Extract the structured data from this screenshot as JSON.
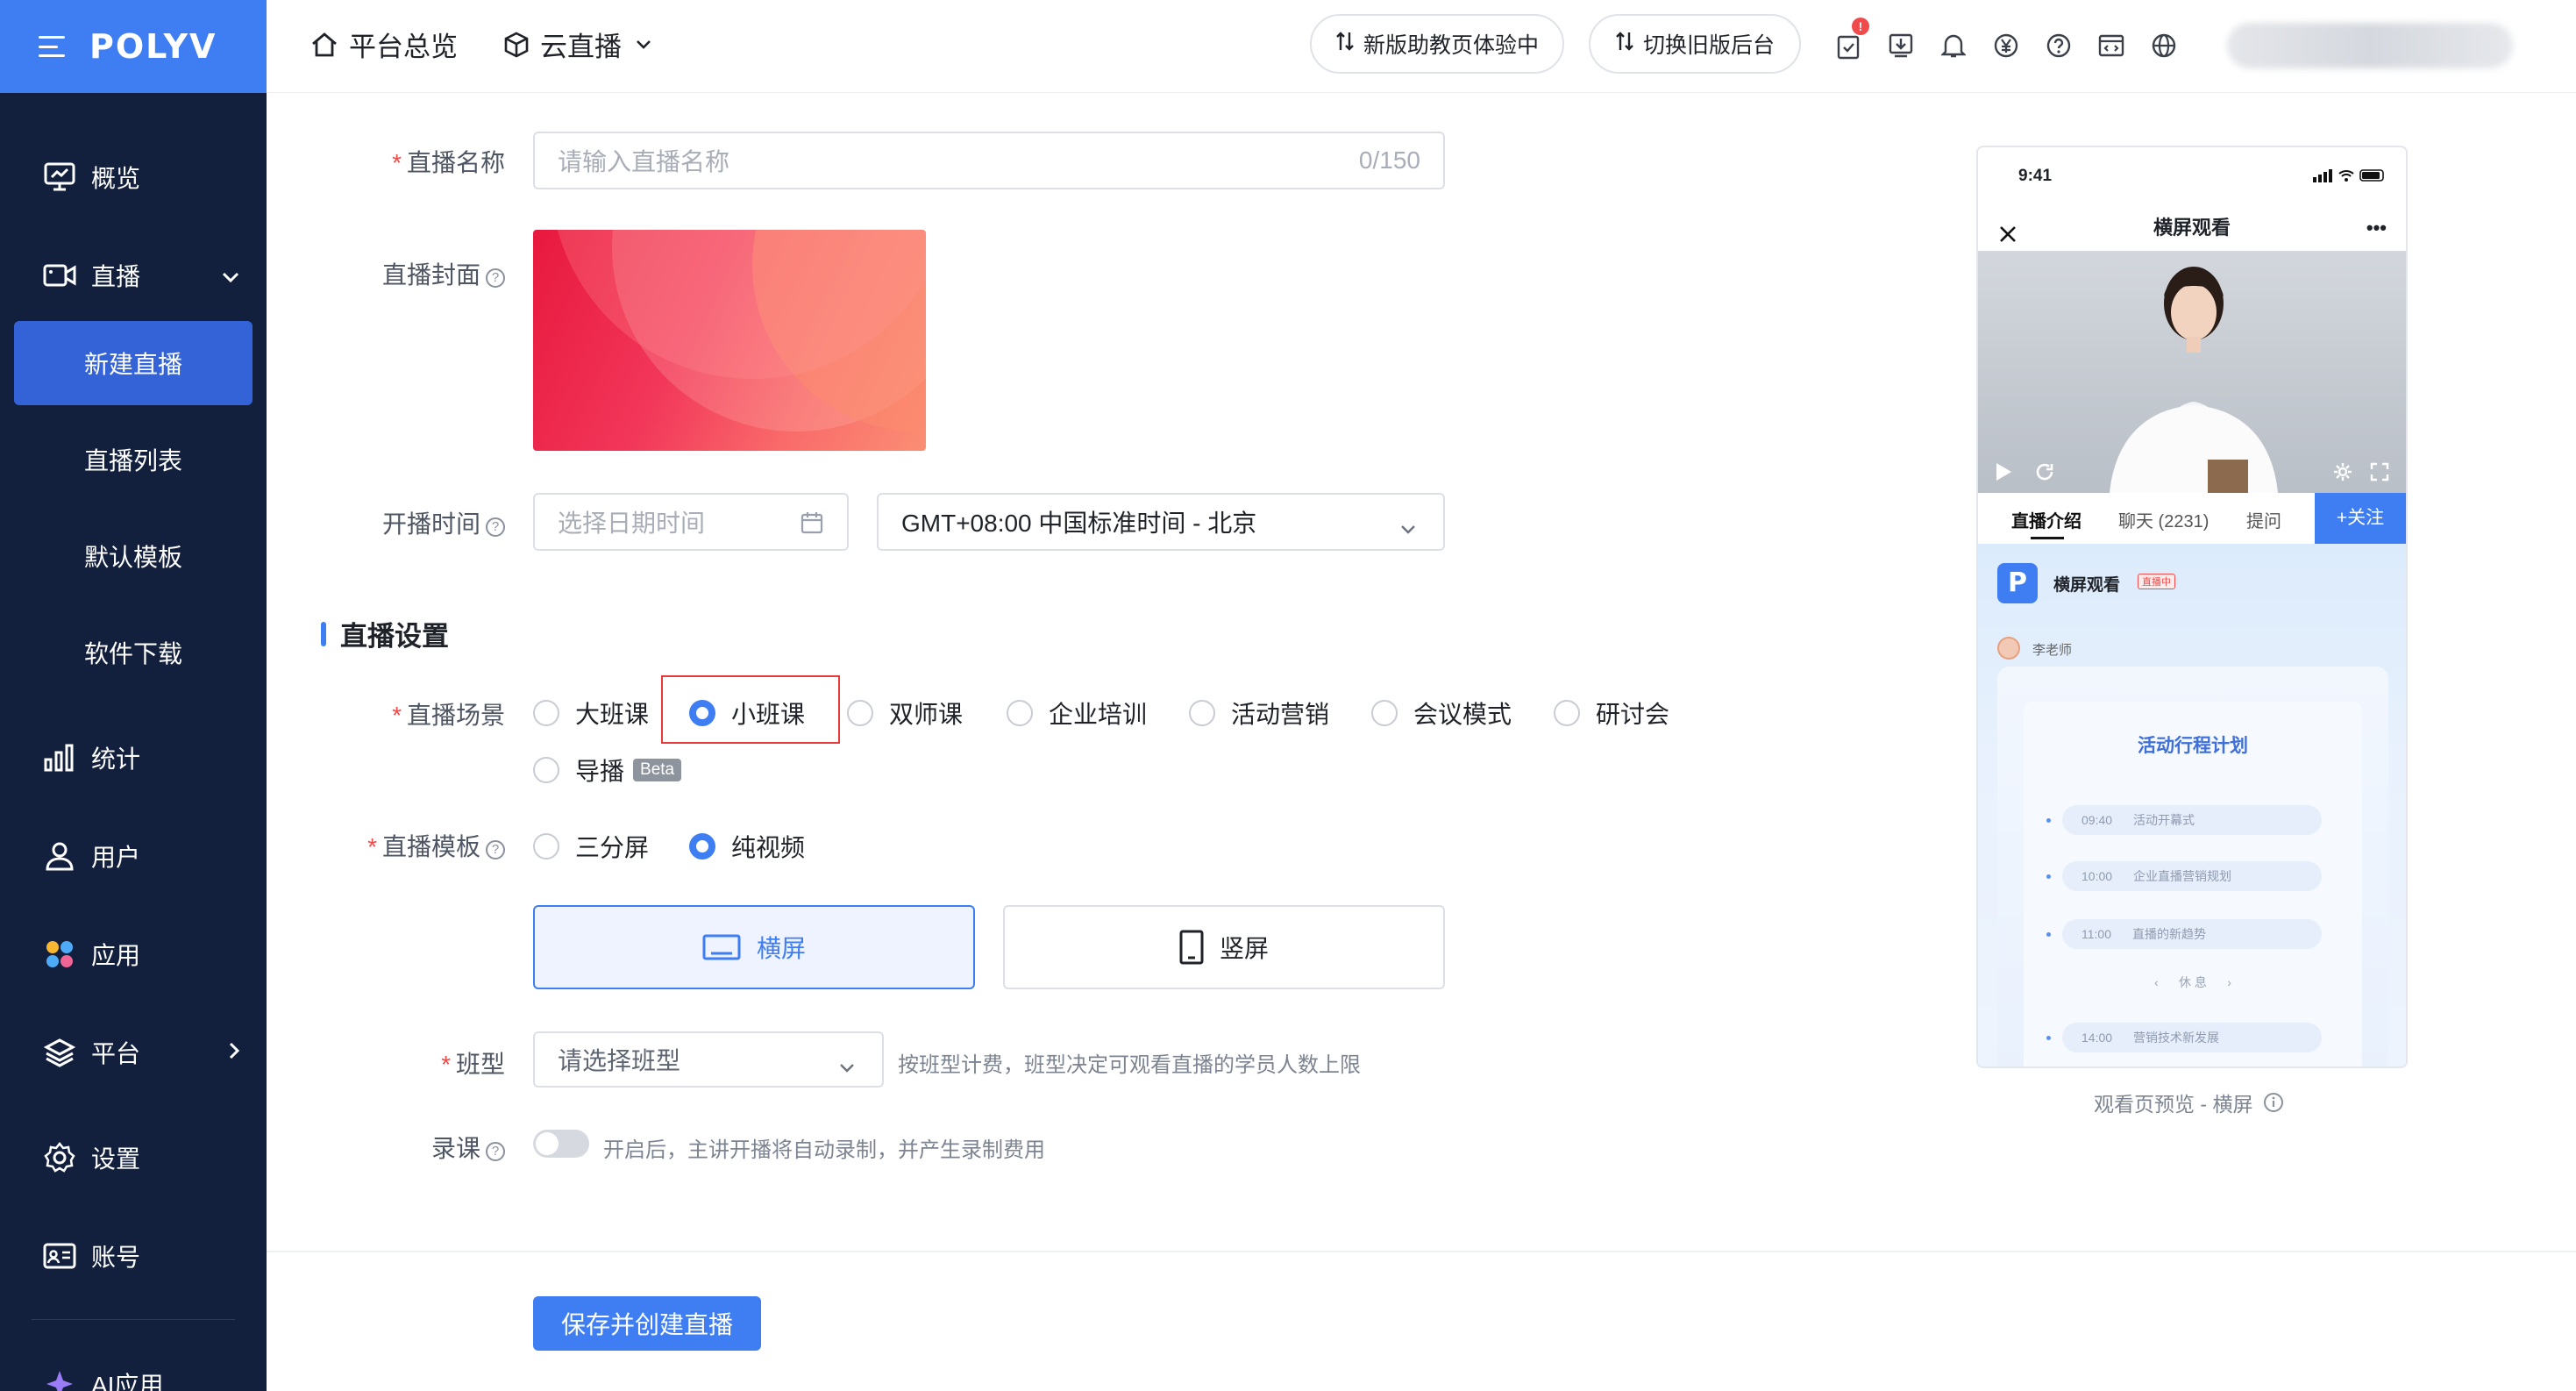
{
  "brand": {
    "logo_text": "POLYV"
  },
  "sidebar": {
    "items": [
      {
        "label": "概览",
        "icon": "monitor-icon"
      },
      {
        "label": "直播",
        "icon": "video-camera-icon"
      },
      {
        "label": "统计",
        "icon": "bar-chart-icon"
      },
      {
        "label": "用户",
        "icon": "user-icon"
      },
      {
        "label": "应用",
        "icon": "apps-icon"
      },
      {
        "label": "平台",
        "icon": "layers-icon"
      },
      {
        "label": "设置",
        "icon": "gear-icon"
      },
      {
        "label": "账号",
        "icon": "id-card-icon"
      },
      {
        "label": "AI应用",
        "icon": "sparkle-icon"
      }
    ],
    "sub_items": [
      {
        "label": "新建直播",
        "active": true
      },
      {
        "label": "直播列表"
      },
      {
        "label": "默认模板"
      },
      {
        "label": "软件下载"
      }
    ]
  },
  "header": {
    "nav_home": "平台总览",
    "nav_product": "云直播",
    "pill_assistant": "新版助教页体验中",
    "pill_switch": "切换旧版后台",
    "notification_badge": "!"
  },
  "form": {
    "name_label": "直播名称",
    "name_placeholder": "请输入直播名称",
    "name_counter": "0/150",
    "cover_label": "直播封面",
    "time_label": "开播时间",
    "time_placeholder": "选择日期时间",
    "timezone_value": "GMT+08:00 中国标准时间 - 北京",
    "section_title": "直播设置",
    "scene_label": "直播场景",
    "scene_options": [
      "大班课",
      "小班课",
      "双师课",
      "企业培训",
      "活动营销",
      "会议模式",
      "研讨会",
      "导播"
    ],
    "scene_selected": "小班课",
    "beta_tag": "Beta",
    "template_label": "直播模板",
    "template_options": [
      "三分屏",
      "纯视频"
    ],
    "template_selected": "纯视频",
    "orientation_landscape": "横屏",
    "orientation_portrait": "竖屏",
    "class_type_label": "班型",
    "class_type_placeholder": "请选择班型",
    "class_type_hint": "按班型计费，班型决定可观看直播的学员人数上限",
    "record_label": "录课",
    "record_hint": "开启后，主讲开播将自动录制，并产生录制费用",
    "save_button": "保存并创建直播"
  },
  "preview": {
    "status_time": "9:41",
    "title": "横屏观看",
    "tabs": [
      "直播介绍",
      "聊天 (2231)",
      "提问"
    ],
    "follow_button": "+关注",
    "channel_name": "横屏观看",
    "live_badge": "直播中",
    "teacher": "李老师",
    "schedule_title": "活动行程计划",
    "schedule": [
      {
        "time": "09:40",
        "text": "活动开幕式"
      },
      {
        "time": "10:00",
        "text": "企业直播营销规划"
      },
      {
        "time": "11:00",
        "text": "直播的新趋势"
      },
      {
        "time": "",
        "text": "休 息"
      },
      {
        "time": "14:00",
        "text": "营销技术新发展"
      }
    ],
    "caption": "观看页预览 - 横屏"
  },
  "colors": {
    "primary": "#3e7ef2",
    "sidebar_bg": "#12203d",
    "required": "#f04a4a",
    "highlight_box": "#e83a3a"
  }
}
